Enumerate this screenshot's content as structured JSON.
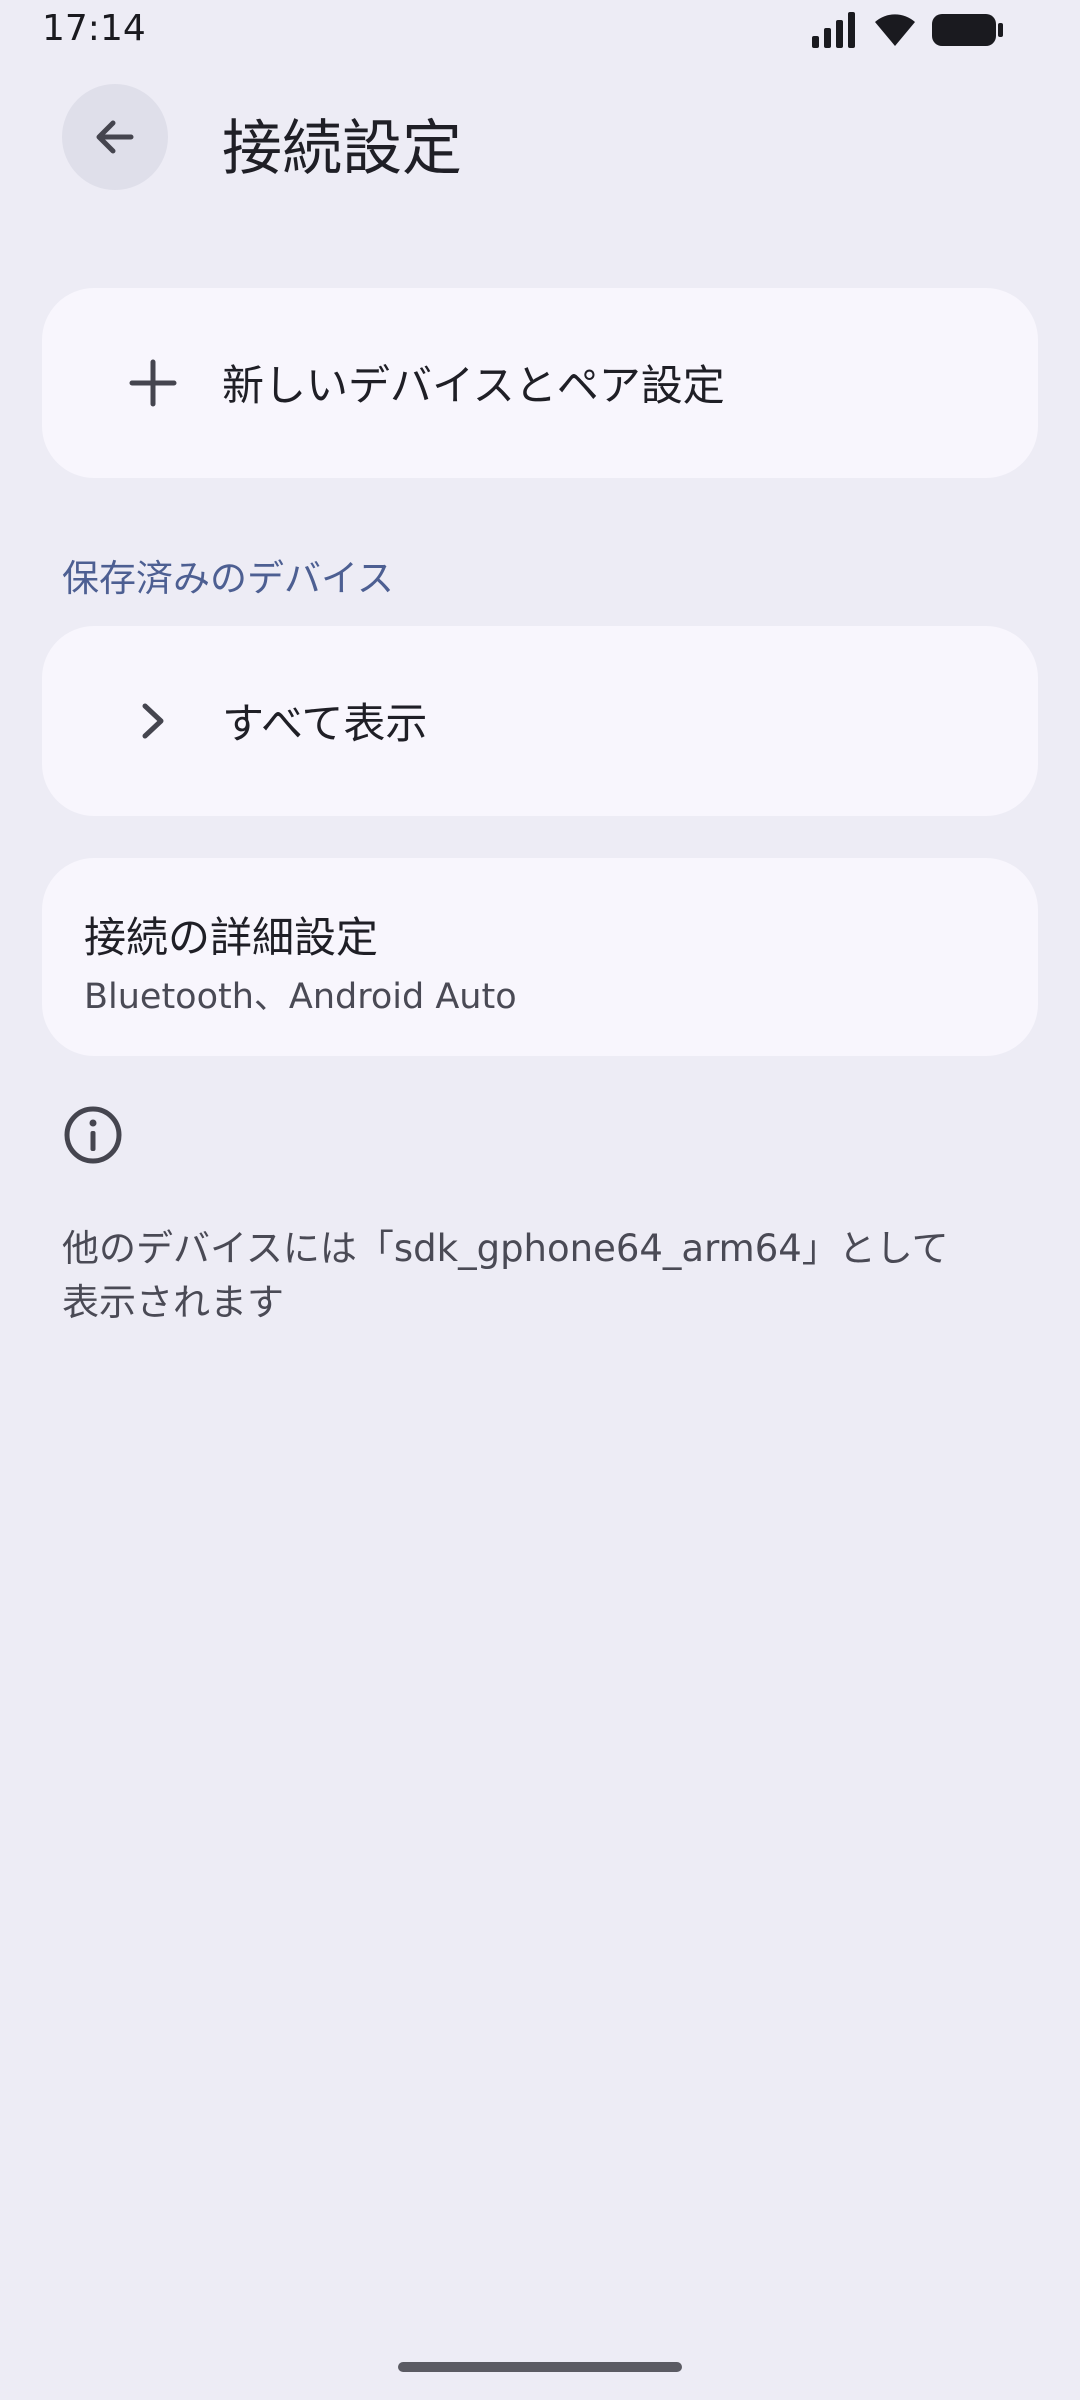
{
  "status_bar": {
    "time": "17:14",
    "icons": [
      "signal-icon",
      "wifi-icon",
      "battery-icon"
    ]
  },
  "header": {
    "back_icon": "arrow-back-icon",
    "title": "接続設定"
  },
  "pair_card": {
    "icon": "plus-icon",
    "label": "新しいデバイスとペア設定"
  },
  "saved_devices": {
    "header": "保存済みのデバイス",
    "see_all_icon": "chevron-right-icon",
    "see_all_label": "すべて表示"
  },
  "advanced": {
    "title": "接続の詳細設定",
    "summary": "Bluetooth、Android Auto"
  },
  "footer": {
    "info_icon": "info-icon",
    "line1": "他のデバイスには「sdk_gphone64_arm64」として",
    "line2": "表示されます"
  },
  "colors": {
    "background": "#EDECF5",
    "card": "#F8F6FD",
    "accent": "#4D5F92",
    "back_button": "#DFDFEA"
  }
}
